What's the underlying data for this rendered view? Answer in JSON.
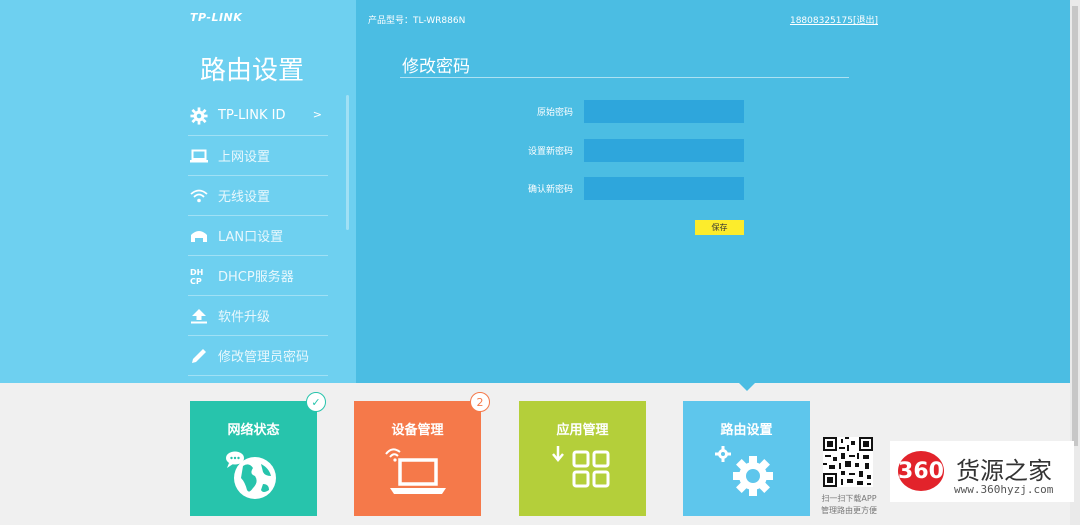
{
  "header": {
    "logo": "TP-LINK",
    "model": "产品型号：TL-WR886N",
    "account": "18808325175",
    "logout": "[退出]"
  },
  "sidebar": {
    "title": "路由设置",
    "items": [
      {
        "label": "TP-LINK ID",
        "icon": "gear-icon",
        "arrow": ">"
      },
      {
        "label": "上网设置",
        "icon": "laptop-icon"
      },
      {
        "label": "无线设置",
        "icon": "wifi-icon"
      },
      {
        "label": "LAN口设置",
        "icon": "lan-icon"
      },
      {
        "label": "DHCP服务器",
        "icon": "dhcp-icon"
      },
      {
        "label": "软件升级",
        "icon": "upgrade-icon"
      },
      {
        "label": "修改管理员密码",
        "icon": "pencil-icon"
      }
    ]
  },
  "panel": {
    "title": "修改密码",
    "fields": [
      {
        "label": "原始密码",
        "value": ""
      },
      {
        "label": "设置新密码",
        "value": ""
      },
      {
        "label": "确认新密码",
        "value": ""
      }
    ],
    "save_label": "保存"
  },
  "tiles": [
    {
      "label": "网络状态",
      "color": "#27c4ac",
      "badge": "✓"
    },
    {
      "label": "设备管理",
      "color": "#f5794a",
      "badge": "2"
    },
    {
      "label": "应用管理",
      "color": "#b4cf3a",
      "badge": ""
    },
    {
      "label": "路由设置",
      "color": "#5ec6ec",
      "badge": ""
    }
  ],
  "qr": {
    "caption_line1": "扫一扫下载APP",
    "caption_line2": "管理路由更方便"
  },
  "watermark": {
    "logo": "360",
    "title": "货源之家",
    "url": "www.360hyzj.com"
  },
  "colors": {
    "sidebar_bg": "#6ed0f0",
    "main_bg": "#4bbde3",
    "input_bg": "#2ea6dc",
    "save_btn": "#fcec2c"
  }
}
